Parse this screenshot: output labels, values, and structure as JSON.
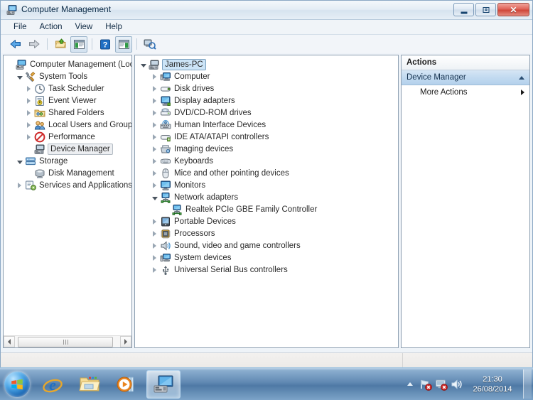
{
  "window": {
    "title": "Computer Management",
    "icon": "computer-management-icon",
    "buttons": {
      "minimize": "Minimize",
      "maximize": "Maximize",
      "close": "Close"
    }
  },
  "menu": {
    "items": [
      "File",
      "Action",
      "View",
      "Help"
    ]
  },
  "toolbar": {
    "items": [
      {
        "name": "back-icon",
        "title": "Back"
      },
      {
        "name": "forward-icon",
        "title": "Forward"
      },
      {
        "name": "up-folder-icon",
        "title": "Up One Level"
      },
      {
        "name": "show-hide-tree-icon",
        "title": "Show/Hide Console Tree"
      },
      {
        "name": "help-icon",
        "title": "Help"
      },
      {
        "name": "show-hide-action-pane-icon",
        "title": "Show/Hide Action Pane"
      },
      {
        "name": "scan-hardware-changes-icon",
        "title": "Scan for hardware changes"
      }
    ]
  },
  "console_tree": {
    "nodes": [
      {
        "label": "Computer Management (Local",
        "indent": 0,
        "expander": "none",
        "icon": "computer-management-icon",
        "state": "none"
      },
      {
        "label": "System Tools",
        "indent": 1,
        "expander": "open",
        "icon": "system-tools-icon",
        "state": "none"
      },
      {
        "label": "Task Scheduler",
        "indent": 2,
        "expander": "closed",
        "icon": "task-scheduler-icon",
        "state": "none"
      },
      {
        "label": "Event Viewer",
        "indent": 2,
        "expander": "closed",
        "icon": "event-viewer-icon",
        "state": "none"
      },
      {
        "label": "Shared Folders",
        "indent": 2,
        "expander": "closed",
        "icon": "shared-folders-icon",
        "state": "none"
      },
      {
        "label": "Local Users and Groups",
        "indent": 2,
        "expander": "closed",
        "icon": "local-users-icon",
        "state": "none"
      },
      {
        "label": "Performance",
        "indent": 2,
        "expander": "closed",
        "icon": "performance-icon",
        "state": "none"
      },
      {
        "label": "Device Manager",
        "indent": 2,
        "expander": "none",
        "icon": "device-manager-icon",
        "state": "selected-inactive"
      },
      {
        "label": "Storage",
        "indent": 1,
        "expander": "open",
        "icon": "storage-icon",
        "state": "none"
      },
      {
        "label": "Disk Management",
        "indent": 2,
        "expander": "none",
        "icon": "disk-management-icon",
        "state": "none"
      },
      {
        "label": "Services and Applications",
        "indent": 1,
        "expander": "closed",
        "icon": "services-icon",
        "state": "none"
      }
    ],
    "scrollbar": {
      "left_arrow": "scroll-left",
      "right_arrow": "scroll-right"
    }
  },
  "device_tree": {
    "nodes": [
      {
        "label": "James-PC",
        "indent": 0,
        "expander": "open",
        "icon": "computer-icon",
        "state": "selected-active"
      },
      {
        "label": "Computer",
        "indent": 1,
        "expander": "closed",
        "icon": "computer-device-icon",
        "state": "none"
      },
      {
        "label": "Disk drives",
        "indent": 1,
        "expander": "closed",
        "icon": "disk-drive-icon",
        "state": "none"
      },
      {
        "label": "Display adapters",
        "indent": 1,
        "expander": "closed",
        "icon": "display-adapter-icon",
        "state": "none"
      },
      {
        "label": "DVD/CD-ROM drives",
        "indent": 1,
        "expander": "closed",
        "icon": "dvd-drive-icon",
        "state": "none"
      },
      {
        "label": "Human Interface Devices",
        "indent": 1,
        "expander": "closed",
        "icon": "hid-icon",
        "state": "none"
      },
      {
        "label": "IDE ATA/ATAPI controllers",
        "indent": 1,
        "expander": "closed",
        "icon": "ide-controller-icon",
        "state": "none"
      },
      {
        "label": "Imaging devices",
        "indent": 1,
        "expander": "closed",
        "icon": "imaging-device-icon",
        "state": "none"
      },
      {
        "label": "Keyboards",
        "indent": 1,
        "expander": "closed",
        "icon": "keyboard-icon",
        "state": "none"
      },
      {
        "label": "Mice and other pointing devices",
        "indent": 1,
        "expander": "closed",
        "icon": "mouse-icon",
        "state": "none"
      },
      {
        "label": "Monitors",
        "indent": 1,
        "expander": "closed",
        "icon": "monitor-icon",
        "state": "none"
      },
      {
        "label": "Network adapters",
        "indent": 1,
        "expander": "open",
        "icon": "network-adapter-icon",
        "state": "none"
      },
      {
        "label": "Realtek PCIe GBE Family Controller",
        "indent": 2,
        "expander": "none",
        "icon": "network-adapter-icon",
        "state": "none"
      },
      {
        "label": "Portable Devices",
        "indent": 1,
        "expander": "closed",
        "icon": "portable-device-icon",
        "state": "none"
      },
      {
        "label": "Processors",
        "indent": 1,
        "expander": "closed",
        "icon": "processor-icon",
        "state": "none"
      },
      {
        "label": "Sound, video and game controllers",
        "indent": 1,
        "expander": "closed",
        "icon": "sound-icon",
        "state": "none"
      },
      {
        "label": "System devices",
        "indent": 1,
        "expander": "closed",
        "icon": "system-device-icon",
        "state": "none"
      },
      {
        "label": "Universal Serial Bus controllers",
        "indent": 1,
        "expander": "closed",
        "icon": "usb-icon",
        "state": "none"
      }
    ]
  },
  "actions": {
    "title": "Actions",
    "group_label": "Device Manager",
    "collapse_icon": "chevron-up-icon",
    "items": [
      {
        "label": "More Actions",
        "submenu_icon": "chevron-right-icon"
      }
    ]
  },
  "statusbar": {
    "text": ""
  },
  "taskbar": {
    "start": "start-orb",
    "items": [
      {
        "name": "taskbar-item-internet-explorer",
        "icon": "internet-explorer-icon",
        "active": false
      },
      {
        "name": "taskbar-item-explorer",
        "icon": "windows-explorer-icon",
        "active": false
      },
      {
        "name": "taskbar-item-media-player",
        "icon": "windows-media-player-icon",
        "active": false
      },
      {
        "name": "taskbar-item-computer-management",
        "icon": "computer-management-icon",
        "active": true
      }
    ],
    "tray": {
      "show_hidden": "tray-expand-icon",
      "icons": [
        {
          "name": "network-error-icon"
        },
        {
          "name": "action-center-error-icon"
        },
        {
          "name": "volume-icon"
        }
      ],
      "time": "21:30",
      "date": "26/08/2014"
    }
  },
  "colors": {
    "titlebar_text": "#0a2a46",
    "selection_active": "#cce4f7",
    "selection_inactive": "#eceef1",
    "actions_group": "#c2daf0",
    "taskbar": "#5f8cb4"
  }
}
